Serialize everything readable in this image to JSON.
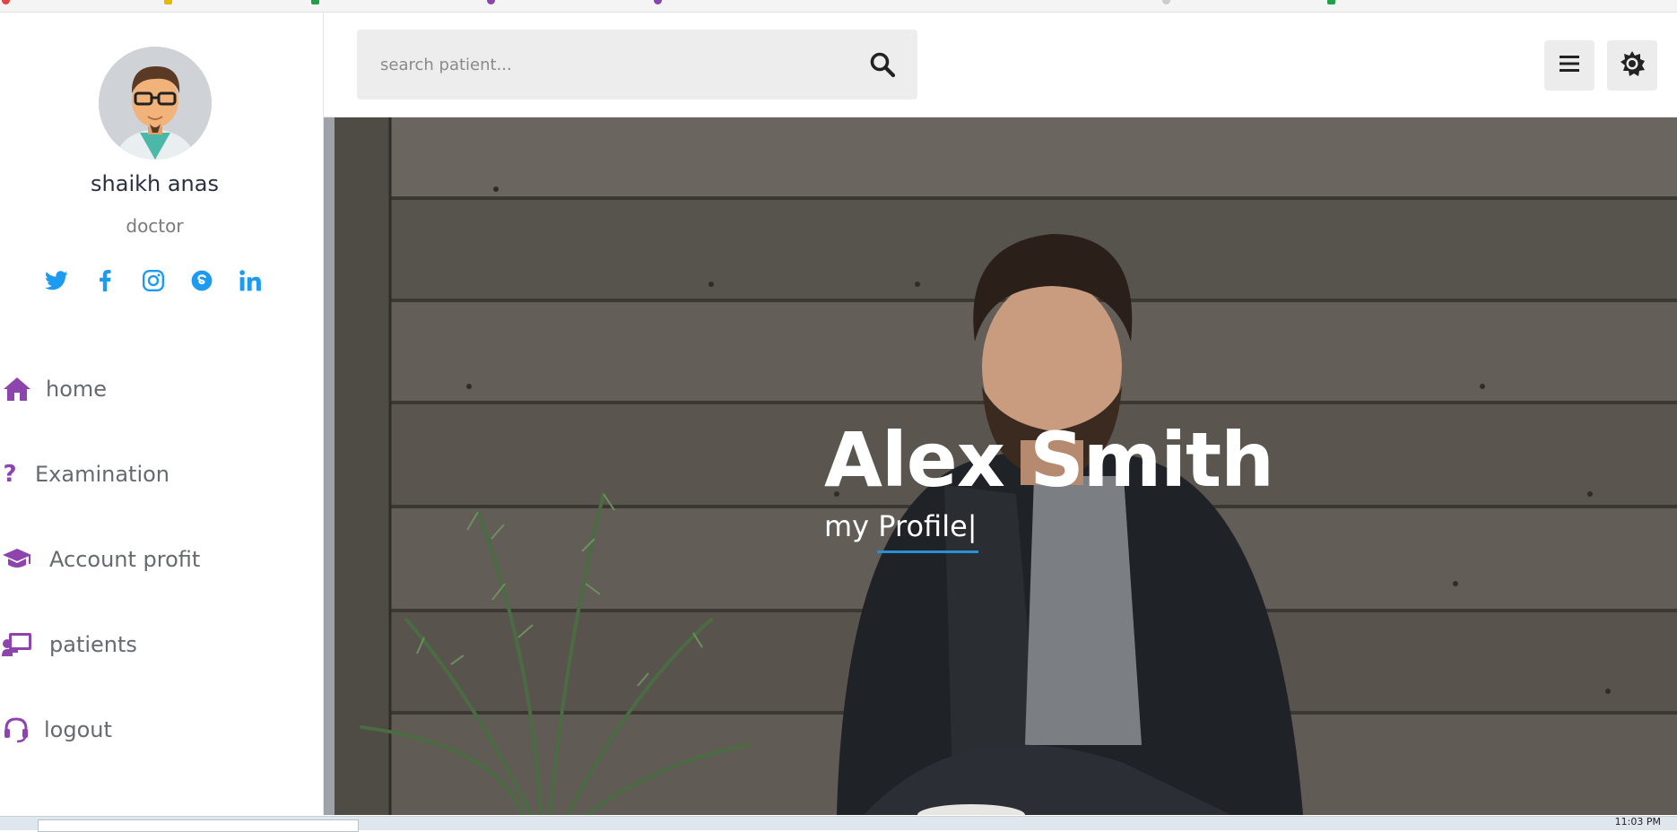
{
  "profile": {
    "name": "shaikh anas",
    "role": "doctor",
    "social": [
      "twitter-icon",
      "facebook-icon",
      "instagram-icon",
      "skype-icon",
      "linkedin-icon"
    ]
  },
  "nav": {
    "items": [
      {
        "label": "home",
        "icon": "home-icon"
      },
      {
        "label": "Examination",
        "icon": "question-icon"
      },
      {
        "label": "Account profit",
        "icon": "graduation-cap-icon"
      },
      {
        "label": "patients",
        "icon": "presentation-icon"
      },
      {
        "label": "logout",
        "icon": "headset-icon"
      }
    ]
  },
  "search": {
    "placeholder": "search patient...",
    "icon": "search-icon"
  },
  "header": {
    "menu_icon": "hamburger-menu-icon",
    "theme_icon": "brightness-icon"
  },
  "hero": {
    "title": "Alex Smith",
    "subtitle": "my Profile|"
  },
  "taskbar": {
    "time": "11:03 PM"
  },
  "colors": {
    "accent_purple": "#8e44ad",
    "social_blue": "#1d9bf0",
    "underline_blue": "#2b8fd6",
    "name_dark": "#2b3040"
  }
}
